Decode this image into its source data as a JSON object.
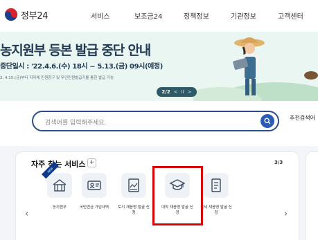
{
  "header": {
    "logo_text": "정부24",
    "nav": [
      "서비스",
      "보조금24",
      "정책정보",
      "기관정보",
      "고객센터"
    ]
  },
  "banner": {
    "title": "농지원부 등본 발급 중단 안내",
    "subtitle": "중단일시 : '22.4.6.(수) 18시 ~ 5.13.(금) 09시(예정)",
    "note": "2. 4.15.(금)부터 지자체 민원창구 및 무인민원발급기를 통한 발급 가능",
    "pager": {
      "count": "2/2",
      "prev": "<",
      "pause": "II",
      "next": ">"
    }
  },
  "search": {
    "placeholder": "검색어를 입력해주세요.",
    "recommend_label": "추천검색어"
  },
  "services": {
    "title": "자주 찾는 서비스",
    "plus": "+",
    "page": "3/3",
    "items": [
      {
        "label": "농지원부",
        "icon": "farmhouse-icon"
      },
      {
        "label": "국민연금 가입내역",
        "icon": "id-card-icon"
      },
      {
        "label": "토지 재응명 발굴 신청",
        "icon": "map-document-icon"
      },
      {
        "label": "대학 재응명 발굴 신청",
        "icon": "graduation-cap-icon"
      },
      {
        "label": "국세 재응명 발굴 신청",
        "icon": "tax-document-icon"
      }
    ],
    "prev": "‹",
    "next": "›",
    "badge": "NEW"
  },
  "colors": {
    "accent": "#2b4d8a",
    "highlight": "#d90000",
    "banner_bg": "#eaf6f2"
  }
}
